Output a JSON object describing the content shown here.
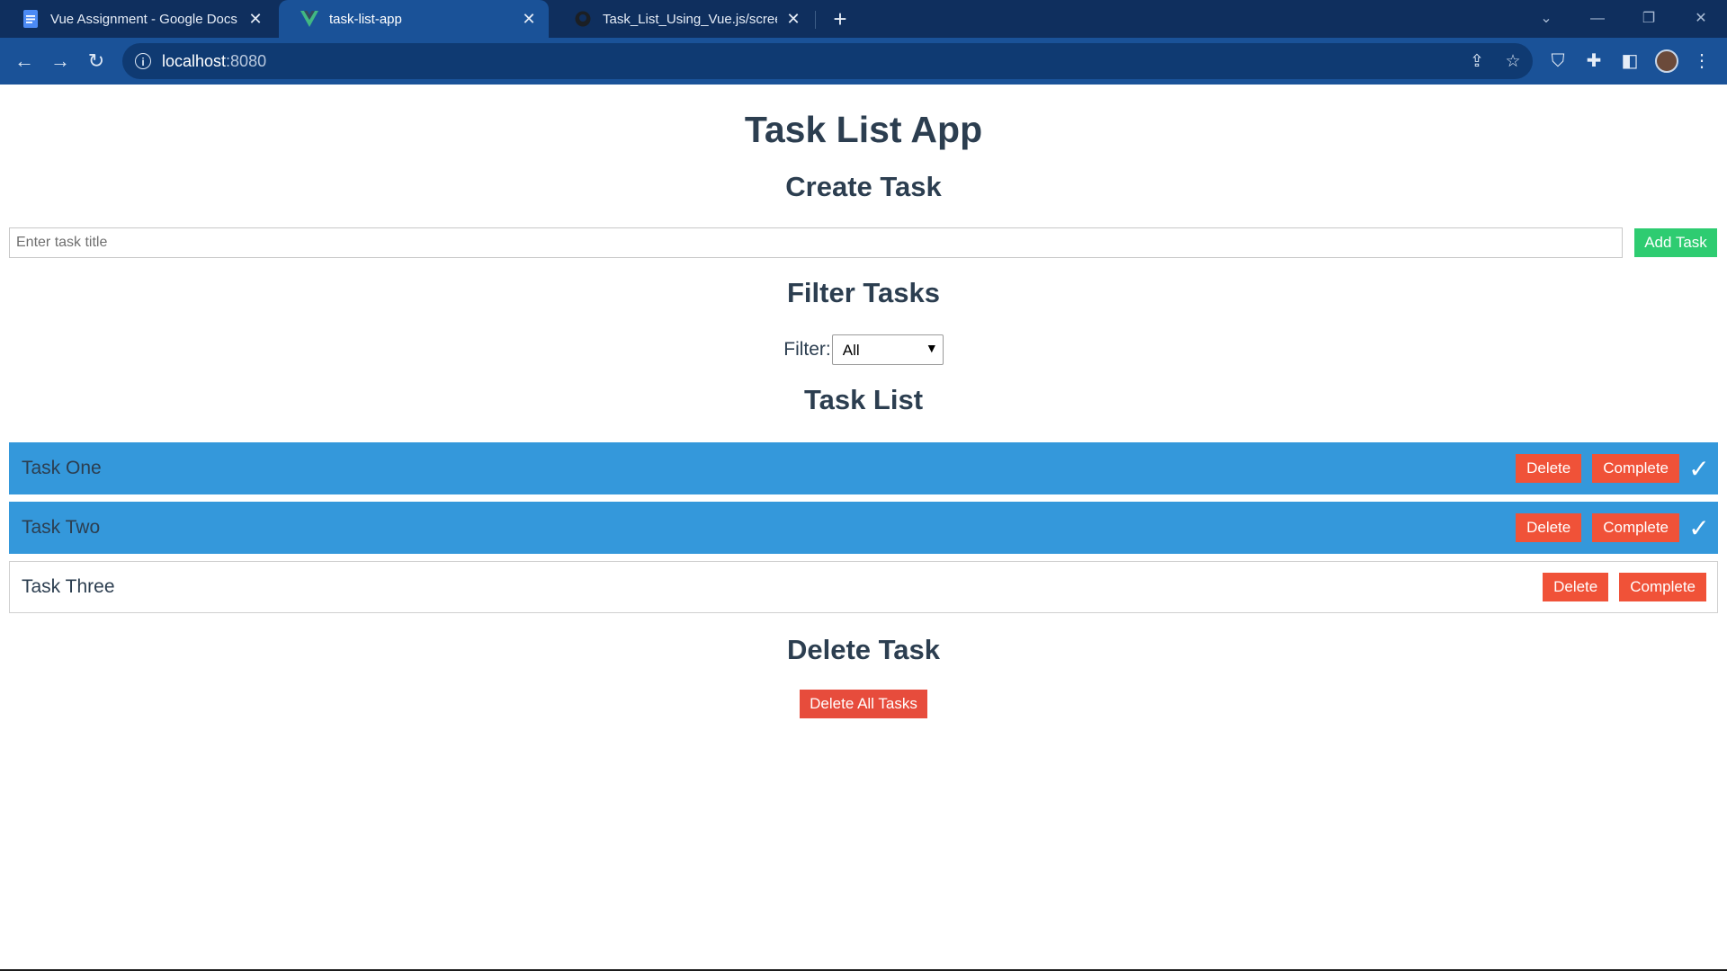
{
  "browser": {
    "tabs": [
      {
        "title": "Vue Assignment - Google Docs",
        "icon": "google-docs-icon"
      },
      {
        "title": "task-list-app",
        "icon": "vue-icon"
      },
      {
        "title": "Task_List_Using_Vue.js/screensho",
        "icon": "github-icon"
      }
    ],
    "url_host": "localhost",
    "url_port": ":8080"
  },
  "app": {
    "title": "Task List App",
    "create": {
      "heading": "Create Task",
      "input_placeholder": "Enter task title",
      "input_value": "",
      "add_label": "Add Task"
    },
    "filter": {
      "heading": "Filter Tasks",
      "label": "Filter:",
      "selected": "All"
    },
    "list": {
      "heading": "Task List",
      "tasks": [
        {
          "title": "Task One",
          "completed": true
        },
        {
          "title": "Task Two",
          "completed": true
        },
        {
          "title": "Task Three",
          "completed": false
        }
      ],
      "delete_label": "Delete",
      "complete_label": "Complete",
      "completed_mark": "✓"
    },
    "delete": {
      "heading": "Delete Task",
      "button_label": "Delete All Tasks"
    }
  },
  "colors": {
    "completed_row": "#3498db",
    "add_button": "#2ecc71",
    "danger_button": "#f05238",
    "heading_text": "#2c3e50"
  }
}
